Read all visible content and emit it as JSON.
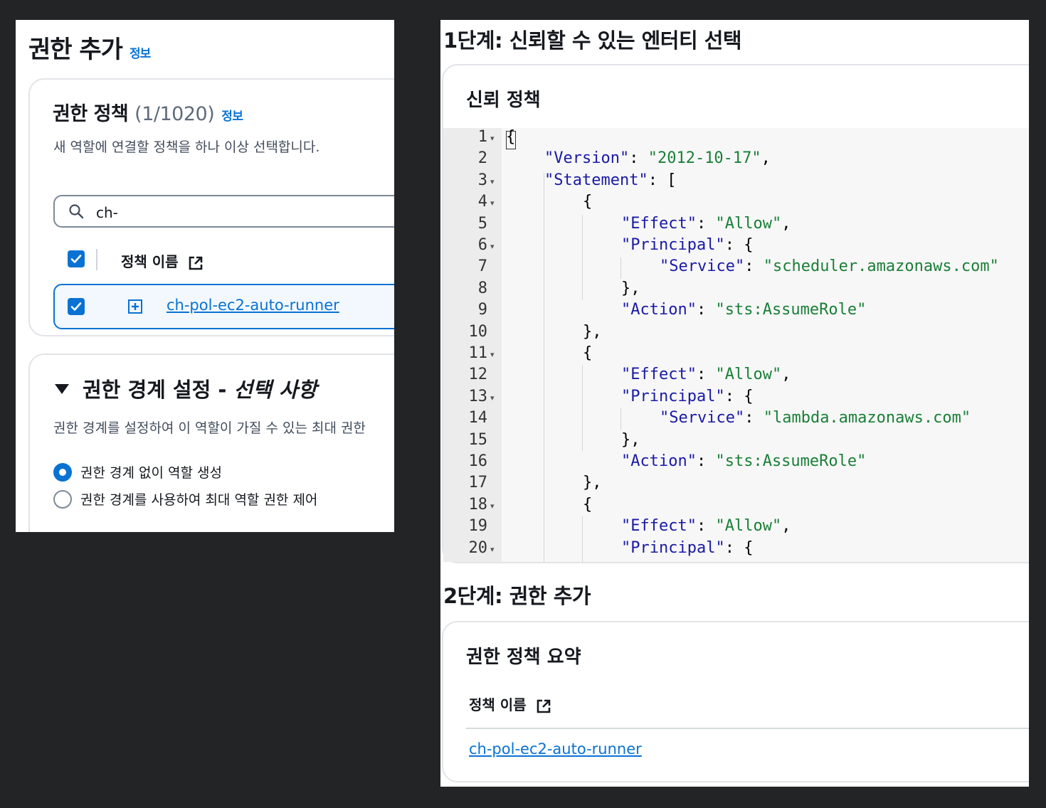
{
  "left": {
    "title": "권한 추가",
    "title_info": "정보",
    "policies_card": {
      "title": "권한 정책",
      "count": "(1/1020)",
      "info": "정보",
      "description": "새 역할에 연결할 정책을 하나 이상 선택합니다.",
      "search_value": "ch-",
      "column_header": "정책 이름",
      "header_checked": true,
      "row": {
        "checked": true,
        "policy_name": "ch-pol-ec2-auto-runner"
      }
    },
    "boundary_card": {
      "title": "권한 경계 설정 - ",
      "title_italic": "선택 사항",
      "description": "권한 경계를 설정하여 이 역할이 가질 수 있는 최대 권한",
      "options": [
        {
          "label": "권한 경계 없이 역할 생성",
          "selected": true
        },
        {
          "label": "권한 경계를 사용하여 최대 역할 권한 제어",
          "selected": false
        }
      ]
    }
  },
  "right": {
    "step1_title": "1단계: 신뢰할 수 있는 엔터티 선택",
    "trust_card_title": "신뢰 정책",
    "code_lines": [
      {
        "n": "1",
        "fold": true,
        "indent": 0,
        "text": "{"
      },
      {
        "n": "2",
        "fold": false,
        "indent": 1,
        "text": "\"Version\": \"2012-10-17\","
      },
      {
        "n": "3",
        "fold": true,
        "indent": 1,
        "text": "\"Statement\": ["
      },
      {
        "n": "4",
        "fold": true,
        "indent": 2,
        "text": "{"
      },
      {
        "n": "5",
        "fold": false,
        "indent": 3,
        "text": "\"Effect\": \"Allow\","
      },
      {
        "n": "6",
        "fold": true,
        "indent": 3,
        "text": "\"Principal\": {"
      },
      {
        "n": "7",
        "fold": false,
        "indent": 4,
        "text": "\"Service\": \"scheduler.amazonaws.com\""
      },
      {
        "n": "8",
        "fold": false,
        "indent": 3,
        "text": "},"
      },
      {
        "n": "9",
        "fold": false,
        "indent": 3,
        "text": "\"Action\": \"sts:AssumeRole\""
      },
      {
        "n": "10",
        "fold": false,
        "indent": 2,
        "text": "},"
      },
      {
        "n": "11",
        "fold": true,
        "indent": 2,
        "text": "{"
      },
      {
        "n": "12",
        "fold": false,
        "indent": 3,
        "text": "\"Effect\": \"Allow\","
      },
      {
        "n": "13",
        "fold": true,
        "indent": 3,
        "text": "\"Principal\": {"
      },
      {
        "n": "14",
        "fold": false,
        "indent": 4,
        "text": "\"Service\": \"lambda.amazonaws.com\""
      },
      {
        "n": "15",
        "fold": false,
        "indent": 3,
        "text": "},"
      },
      {
        "n": "16",
        "fold": false,
        "indent": 3,
        "text": "\"Action\": \"sts:AssumeRole\""
      },
      {
        "n": "17",
        "fold": false,
        "indent": 2,
        "text": "},"
      },
      {
        "n": "18",
        "fold": true,
        "indent": 2,
        "text": "{"
      },
      {
        "n": "19",
        "fold": false,
        "indent": 3,
        "text": "\"Effect\": \"Allow\","
      },
      {
        "n": "20",
        "fold": true,
        "indent": 3,
        "text": "\"Principal\": {"
      }
    ],
    "step2_title": "2단계: 권한 추가",
    "summary_card_title": "권한 정책 요약",
    "summary_column_header": "정책 이름",
    "summary_policy_name": "ch-pol-ec2-auto-runner"
  },
  "colors": {
    "link": "#0972d3",
    "background": "#232425",
    "json_key": "#1a1aa6",
    "json_string": "#1a7f37"
  }
}
